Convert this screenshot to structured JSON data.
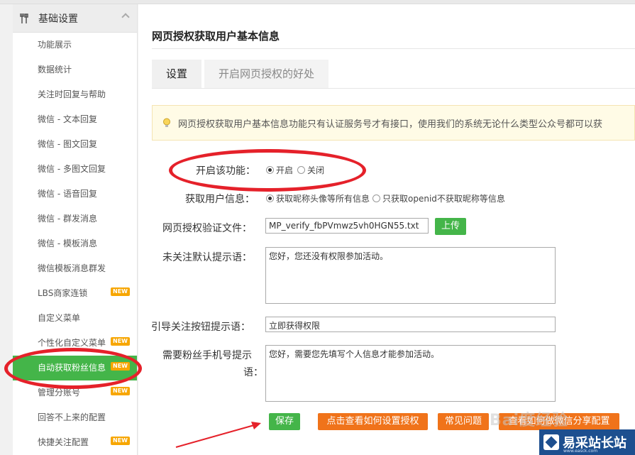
{
  "sidebar": {
    "section_title": "基础设置",
    "items": [
      {
        "label": "功能展示",
        "badge": ""
      },
      {
        "label": "数据统计",
        "badge": ""
      },
      {
        "label": "关注时回复与帮助",
        "badge": ""
      },
      {
        "label": "微信 - 文本回复",
        "badge": ""
      },
      {
        "label": "微信 - 图文回复",
        "badge": ""
      },
      {
        "label": "微信 - 多图文回复",
        "badge": ""
      },
      {
        "label": "微信 - 语音回复",
        "badge": ""
      },
      {
        "label": "微信 - 群发消息",
        "badge": ""
      },
      {
        "label": "微信 - 模板消息",
        "badge": ""
      },
      {
        "label": "微信模板消息群发",
        "badge": ""
      },
      {
        "label": "LBS商家连锁",
        "badge": "NEW"
      },
      {
        "label": "自定义菜单",
        "badge": ""
      },
      {
        "label": "个性化自定义菜单",
        "badge": "NEW"
      },
      {
        "label": "自动获取粉丝信息",
        "badge": "NEW"
      },
      {
        "label": "管理分账号",
        "badge": "NEW"
      },
      {
        "label": "回答不上来的配置",
        "badge": ""
      },
      {
        "label": "快捷关注配置",
        "badge": "NEW"
      }
    ],
    "active_index": 13
  },
  "main": {
    "title": "网页授权获取用户基本信息",
    "tabs": [
      {
        "label": "设置",
        "active": true
      },
      {
        "label": "开启网页授权的好处",
        "active": false
      }
    ],
    "notice": "网页授权获取用户基本信息功能只有认证服务号才有接口，使用我们的系统无论什么类型公众号都可以获",
    "form": {
      "enable_label": "开启该功能：",
      "enable_options": [
        {
          "label": "开启",
          "checked": true
        },
        {
          "label": "关闭",
          "checked": false
        }
      ],
      "userinfo_label": "获取用户信息：",
      "userinfo_options": [
        {
          "label": "获取昵称头像等所有信息",
          "checked": true
        },
        {
          "label": "只获取openid不获取昵称等信息",
          "checked": false
        }
      ],
      "verify_file_label": "网页授权验证文件：",
      "verify_file_value": "MP_verify_fbPVmwz5vh0HGN55.txt",
      "upload_button": "上传",
      "unfollow_tip_label": "未关注默认提示语：",
      "unfollow_tip_value": "您好，您还没有权限参加活动。",
      "guide_button_label": "引导关注按钮提示语：",
      "guide_button_value": "立即获得权限",
      "phone_tip_label_line1": "需要粉丝手机号提示",
      "phone_tip_label_line2": "语：",
      "phone_tip_value": "您好，需要您先填写个人信息才能参加活动。"
    },
    "buttons": {
      "save": "保存",
      "how_to_auth": "点击查看如何设置授权",
      "faq": "常见问题",
      "share_config": "查看如何做微信分享配置"
    }
  },
  "overlay": {
    "watermark": "Bai度经验",
    "logo_text": "易采站长站",
    "logo_url": "www.easck.com"
  },
  "colors": {
    "green": "#44b549",
    "orange": "#f0731a",
    "annotation_red": "#e5212a",
    "badge": "#f7a600"
  }
}
